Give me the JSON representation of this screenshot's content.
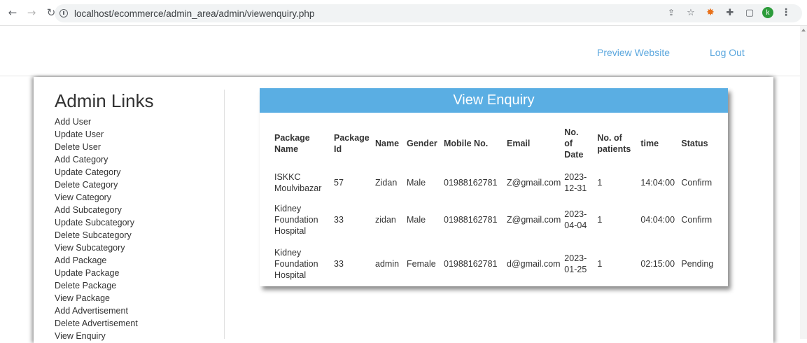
{
  "browser": {
    "url": "localhost/ecommerce/admin_area/admin/viewenquiry.php",
    "avatar_letter": "k"
  },
  "header": {
    "preview_label": "Preview Website",
    "logout_label": "Log Out"
  },
  "sidebar": {
    "title": "Admin Links",
    "items": [
      "Add User",
      "Update User",
      "Delete User",
      "Add Category",
      "Update Category",
      "Delete Category",
      "View Category",
      "Add Subcategory",
      "Update Subcategory",
      "Delete Subcategory",
      "View Subcategory",
      "Add Package",
      "Update Package",
      "Delete Package",
      "View Package",
      "Add Advertisement",
      "Delete Advertisement",
      "View Enquiry"
    ]
  },
  "enquiry": {
    "title": "View Enquiry",
    "columns": [
      "Package Name",
      "Package Id",
      "Name",
      "Gender",
      "Mobile No.",
      "Email",
      "No. of Date",
      "No. of patients",
      "time",
      "Status"
    ],
    "rows": [
      [
        "ISKKC Moulvibazar",
        "57",
        "Zidan",
        "Male",
        "01988162781",
        "Z@gmail.com",
        "2023-12-31",
        "1",
        "14:04:00",
        "Confirm"
      ],
      [
        "Kidney Foundation Hospital",
        "33",
        "zidan",
        "Male",
        "01988162781",
        "Z@gmail.com",
        "2023-04-04",
        "1",
        "04:04:00",
        "Confirm"
      ],
      [
        "Kidney Foundation Hospital",
        "33",
        "admin",
        "Female",
        "01988162781",
        "d@gmail.com",
        "2023-01-25",
        "1",
        "02:15:00",
        "Pending"
      ]
    ]
  },
  "colors": {
    "accent": "#5aaee3",
    "link": "#5ba7de"
  }
}
